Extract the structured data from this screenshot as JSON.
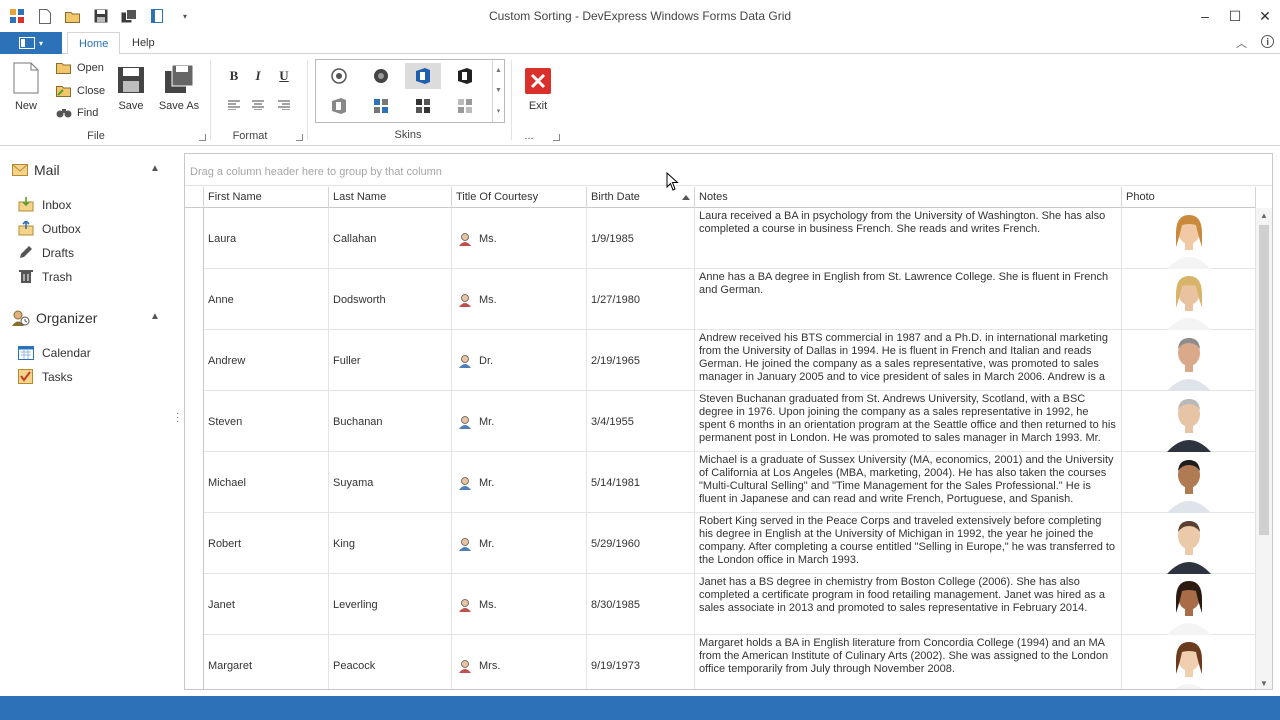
{
  "window": {
    "title": "Custom Sorting - DevExpress Windows Forms Data Grid"
  },
  "ribbon": {
    "tabs": [
      {
        "label": "Home",
        "active": true
      },
      {
        "label": "Help",
        "active": false
      }
    ],
    "file_group": {
      "label": "File",
      "new": "New",
      "open": "Open",
      "close": "Close",
      "find": "Find",
      "save": "Save",
      "save_as": "Save As"
    },
    "format_group": {
      "label": "Format",
      "bold": "B",
      "italic": "I",
      "underline": "U"
    },
    "skins_group": {
      "label": "Skins"
    },
    "exit_group": {
      "exit": "Exit",
      "label": "..."
    }
  },
  "nav": {
    "mail": {
      "label": "Mail",
      "items": [
        "Inbox",
        "Outbox",
        "Drafts",
        "Trash"
      ]
    },
    "organizer": {
      "label": "Organizer",
      "items": [
        "Calendar",
        "Tasks"
      ]
    }
  },
  "grid": {
    "group_panel_hint": "Drag a column header here to group by that column",
    "columns": [
      "First Name",
      "Last Name",
      "Title Of Courtesy",
      "Birth Date",
      "Notes",
      "Photo"
    ],
    "sorted_column": "Birth Date",
    "rows": [
      {
        "first": "Laura",
        "last": "Callahan",
        "courtesy": "Ms.",
        "gender": "f",
        "birth": "1/9/1985",
        "notes": "Laura received a BA in psychology from the University of Washington. She has also completed a course in business French. She reads and writes French."
      },
      {
        "first": "Anne",
        "last": "Dodsworth",
        "courtesy": "Ms.",
        "gender": "f",
        "birth": "1/27/1980",
        "notes": "Anne has a BA degree in English from St. Lawrence College. She is fluent in French and German."
      },
      {
        "first": "Andrew",
        "last": "Fuller",
        "courtesy": "Dr.",
        "gender": "m",
        "birth": "2/19/1965",
        "notes": "Andrew received his BTS commercial in 1987 and a Ph.D. in international marketing from the University of Dallas in 1994. He is fluent in French and Italian and reads German. He joined the company as a sales representative, was promoted to sales manager in January 2005 and to vice president of sales in March 2006. Andrew is a"
      },
      {
        "first": "Steven",
        "last": "Buchanan",
        "courtesy": "Mr.",
        "gender": "m",
        "birth": "3/4/1955",
        "notes": "Steven Buchanan graduated from St. Andrews University, Scotland, with a BSC degree in 1976.  Upon joining the company as a sales representative in 1992, he spent 6 months in an orientation program at the Seattle office and then returned to his permanent post in London.  He was promoted to sales manager in March 1993.  Mr."
      },
      {
        "first": "Michael",
        "last": "Suyama",
        "courtesy": "Mr.",
        "gender": "m",
        "birth": "5/14/1981",
        "notes": "Michael is a graduate of Sussex University (MA, economics, 2001) and the University of California at Los Angeles (MBA, marketing, 2004). He has also taken the courses \"Multi-Cultural Selling\" and \"Time Management for the Sales Professional.\" He is fluent in Japanese and can read and write French, Portuguese, and Spanish."
      },
      {
        "first": "Robert",
        "last": "King",
        "courtesy": "Mr.",
        "gender": "m",
        "birth": "5/29/1960",
        "notes": "Robert King served in the Peace Corps and traveled extensively before completing his degree in English at the University of Michigan in 1992, the year he joined the company.  After completing a course entitled \"Selling in Europe,\" he was transferred to the London office in March 1993."
      },
      {
        "first": "Janet",
        "last": "Leverling",
        "courtesy": "Ms.",
        "gender": "f",
        "birth": "8/30/1985",
        "notes": "Janet has a BS degree in chemistry from Boston College (2006). She has also completed a certificate program in food retailing management. Janet was hired as a sales associate in 2013 and promoted to sales representative in February 2014."
      },
      {
        "first": "Margaret",
        "last": "Peacock",
        "courtesy": "Mrs.",
        "gender": "f",
        "birth": "9/19/1973",
        "notes": "Margaret holds a BA in English literature from Concordia College (1994) and an MA from the American Institute of Culinary Arts (2002). She was assigned to the London office temporarily from July through November 2008."
      }
    ]
  },
  "colors": {
    "accent": "#2b72b8",
    "exit_red": "#d9302c",
    "office_blue": "#1f5fb0"
  }
}
